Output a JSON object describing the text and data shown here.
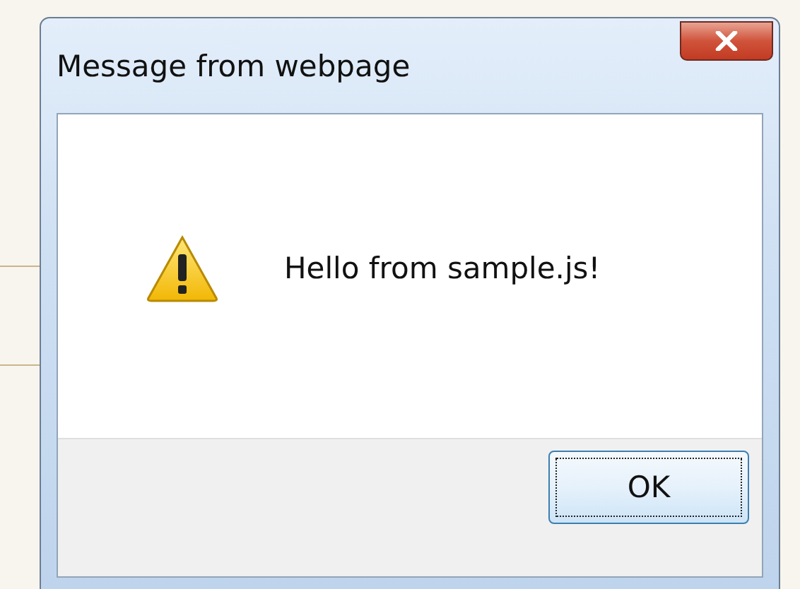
{
  "window": {
    "title": "Message from webpage"
  },
  "message": "Hello from sample.js!",
  "buttons": [
    {
      "label": "OK",
      "focused": true
    }
  ]
}
